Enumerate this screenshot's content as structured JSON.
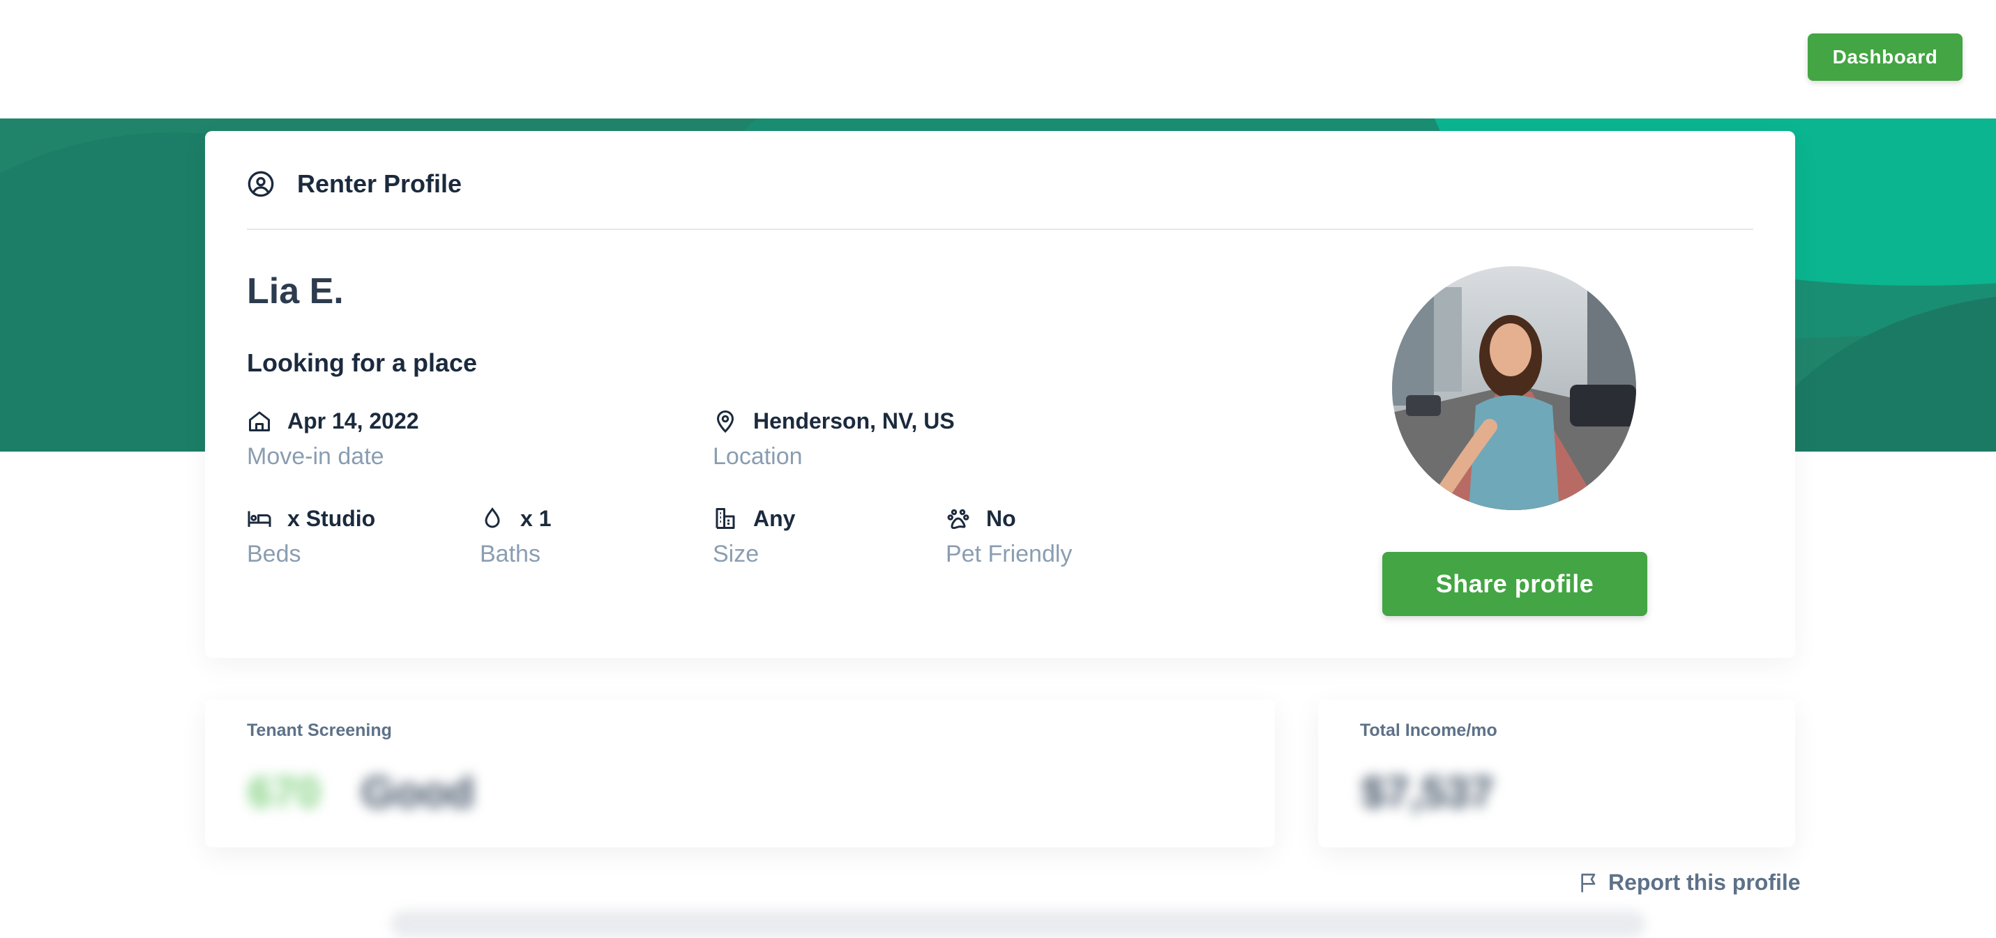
{
  "header": {
    "dashboard_label": "Dashboard"
  },
  "card": {
    "title": "Renter Profile",
    "name": "Lia E.",
    "status": "Looking for a place",
    "move_in": {
      "value": "Apr 14, 2022",
      "label": "Move-in date"
    },
    "location": {
      "value": "Henderson, NV, US",
      "label": "Location"
    },
    "beds": {
      "value": "x Studio",
      "label": "Beds"
    },
    "baths": {
      "value": "x 1",
      "label": "Baths"
    },
    "size": {
      "value": "Any",
      "label": "Size"
    },
    "pets": {
      "value": "No",
      "label": "Pet Friendly"
    },
    "share_label": "Share profile"
  },
  "screening": {
    "label": "Tenant Screening",
    "badge": "670",
    "rating": "Good"
  },
  "income": {
    "label": "Total Income/mo",
    "value": "$7,537"
  },
  "report_label": "Report this profile",
  "colors": {
    "primary_green": "#43a543",
    "band_green": "#20846b",
    "text_dark": "#1b2a3d",
    "label_gray": "#8a9db1"
  },
  "icons": [
    "user-circle-icon",
    "home-icon",
    "location-pin-icon",
    "bed-icon",
    "drop-icon",
    "building-icon",
    "paw-icon",
    "flag-icon"
  ]
}
